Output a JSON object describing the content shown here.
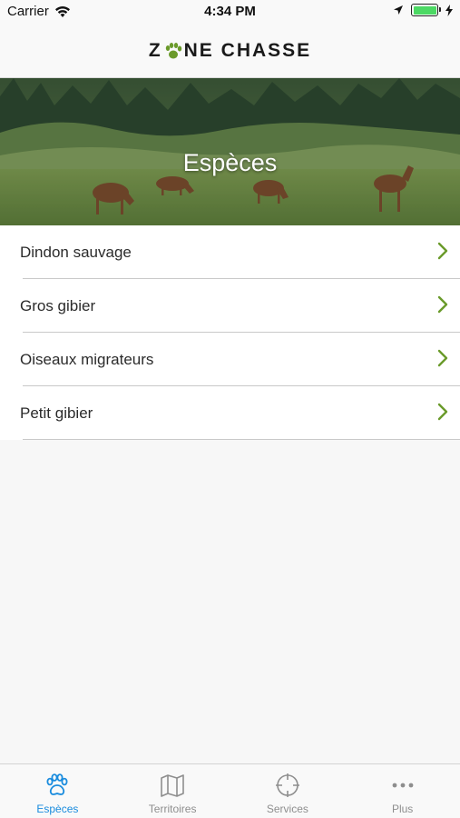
{
  "status_bar": {
    "carrier": "Carrier",
    "time": "4:34 PM"
  },
  "header": {
    "logo_left": "Z",
    "logo_right": "NE CHASSE"
  },
  "hero": {
    "title": "Espèces"
  },
  "list": {
    "items": [
      {
        "label": "Dindon sauvage"
      },
      {
        "label": "Gros gibier"
      },
      {
        "label": "Oiseaux migrateurs"
      },
      {
        "label": "Petit gibier"
      }
    ]
  },
  "tabs": [
    {
      "label": "Espèces",
      "icon": "paw-icon",
      "active": true
    },
    {
      "label": "Territoires",
      "icon": "map-icon",
      "active": false
    },
    {
      "label": "Services",
      "icon": "crosshair-icon",
      "active": false
    },
    {
      "label": "Plus",
      "icon": "more-icon",
      "active": false
    }
  ],
  "colors": {
    "accent": "#1a8cde",
    "chevron": "#6a9a2a",
    "tab_inactive": "#8e8e8e",
    "battery": "#4cd964"
  }
}
